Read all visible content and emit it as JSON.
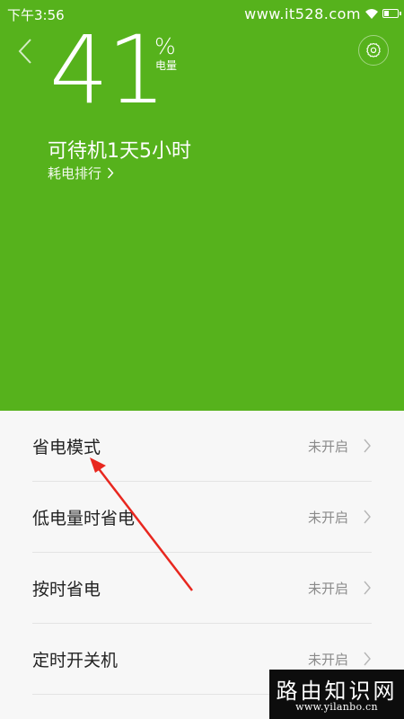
{
  "status_bar": {
    "time": "下午3:56",
    "watermark_text": "www.it528.com",
    "battery_level": 0.41
  },
  "header": {
    "back_icon": "chevron-left-icon",
    "settings_icon": "gear-icon"
  },
  "battery": {
    "percent": "41",
    "percent_sign": "%",
    "percent_label": "电量",
    "standby": "可待机1天5小时",
    "ranking_link": "耗电排行"
  },
  "list": {
    "items": [
      {
        "label": "省电模式",
        "status": "未开启"
      },
      {
        "label": "低电量时省电",
        "status": "未开启"
      },
      {
        "label": "按时省电",
        "status": "未开启"
      },
      {
        "label": "定时开关机",
        "status": "未开启"
      }
    ]
  },
  "watermark": {
    "title": "路由知识网",
    "url": "www.yilanbo.cn"
  },
  "colors": {
    "hero_green": "#56b21c",
    "annotation_red": "#e8271f",
    "list_background": "#f7f7f7"
  }
}
